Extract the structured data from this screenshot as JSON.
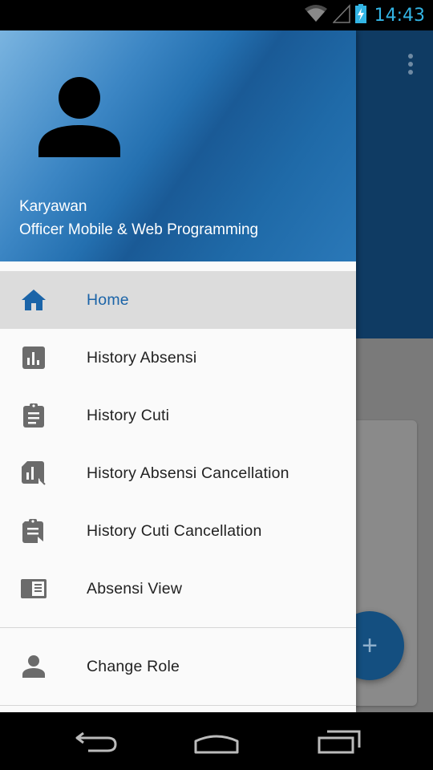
{
  "status_bar": {
    "time": "14:43",
    "icons": [
      "wifi-icon",
      "signal-icon",
      "battery-charging-icon"
    ],
    "color": "#33b5e5"
  },
  "drawer": {
    "header": {
      "avatar_icon": "person-icon",
      "name": "Karyawan",
      "role": "Officer Mobile & Web Programming"
    },
    "items": [
      {
        "label": "Home",
        "icon": "home-icon",
        "selected": true
      },
      {
        "label": "History Absensi",
        "icon": "bar-chart-icon",
        "selected": false
      },
      {
        "label": "History Cuti",
        "icon": "clipboard-icon",
        "selected": false
      },
      {
        "label": "History Absensi Cancellation",
        "icon": "bar-chart-cancel-icon",
        "selected": false
      },
      {
        "label": "History Cuti Cancellation",
        "icon": "clipboard-cancel-icon",
        "selected": false
      },
      {
        "label": "Absensi View",
        "icon": "book-view-icon",
        "selected": false
      }
    ],
    "secondary_items": [
      {
        "label": "Change Role",
        "icon": "person-icon"
      }
    ],
    "accent": "#1b64a8"
  },
  "app": {
    "fab_icon": "plus-icon",
    "fab_label": "+"
  },
  "nav_bar": {
    "icons": [
      "back-icon",
      "home-nav-icon",
      "recents-icon"
    ]
  }
}
